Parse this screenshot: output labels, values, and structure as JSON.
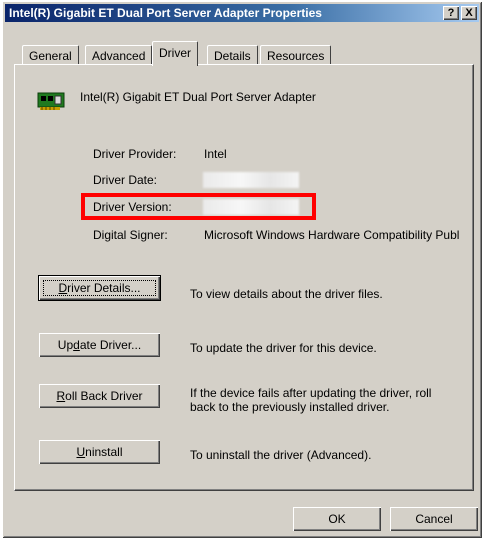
{
  "window": {
    "title": "Intel(R) Gigabit ET Dual Port Server Adapter Properties",
    "help_button": "?",
    "close_button": "X"
  },
  "tabs": [
    {
      "label": "General",
      "active": false
    },
    {
      "label": "Advanced",
      "active": false
    },
    {
      "label": "Driver",
      "active": true
    },
    {
      "label": "Details",
      "active": false
    },
    {
      "label": "Resources",
      "active": false
    }
  ],
  "device": {
    "icon": "network-adapter-icon",
    "name": "Intel(R) Gigabit ET Dual Port Server Adapter"
  },
  "driver_info": {
    "provider_label": "Driver Provider:",
    "provider_value": "Intel",
    "date_label": "Driver Date:",
    "date_value": "",
    "version_label": "Driver Version:",
    "version_value": "",
    "signer_label": "Digital Signer:",
    "signer_value": "Microsoft Windows Hardware Compatibility Publ"
  },
  "actions": [
    {
      "accel": "D",
      "rest": "river Details...",
      "description": "To view details about the driver files."
    },
    {
      "pre": "Up",
      "accel": "d",
      "rest": "ate Driver...",
      "description": "To update the driver for this device."
    },
    {
      "accel": "R",
      "rest": "oll Back Driver",
      "description_line1": "If the device fails after updating the driver, roll",
      "description_line2": "back to the previously installed driver."
    },
    {
      "accel": "U",
      "rest": "ninstall",
      "description": "To uninstall the driver (Advanced)."
    }
  ],
  "footer": {
    "ok_label": "OK",
    "cancel_label": "Cancel"
  },
  "colors": {
    "highlight": "#ff0000",
    "title_bar": "#0a246a",
    "face": "#d4d0c8"
  }
}
